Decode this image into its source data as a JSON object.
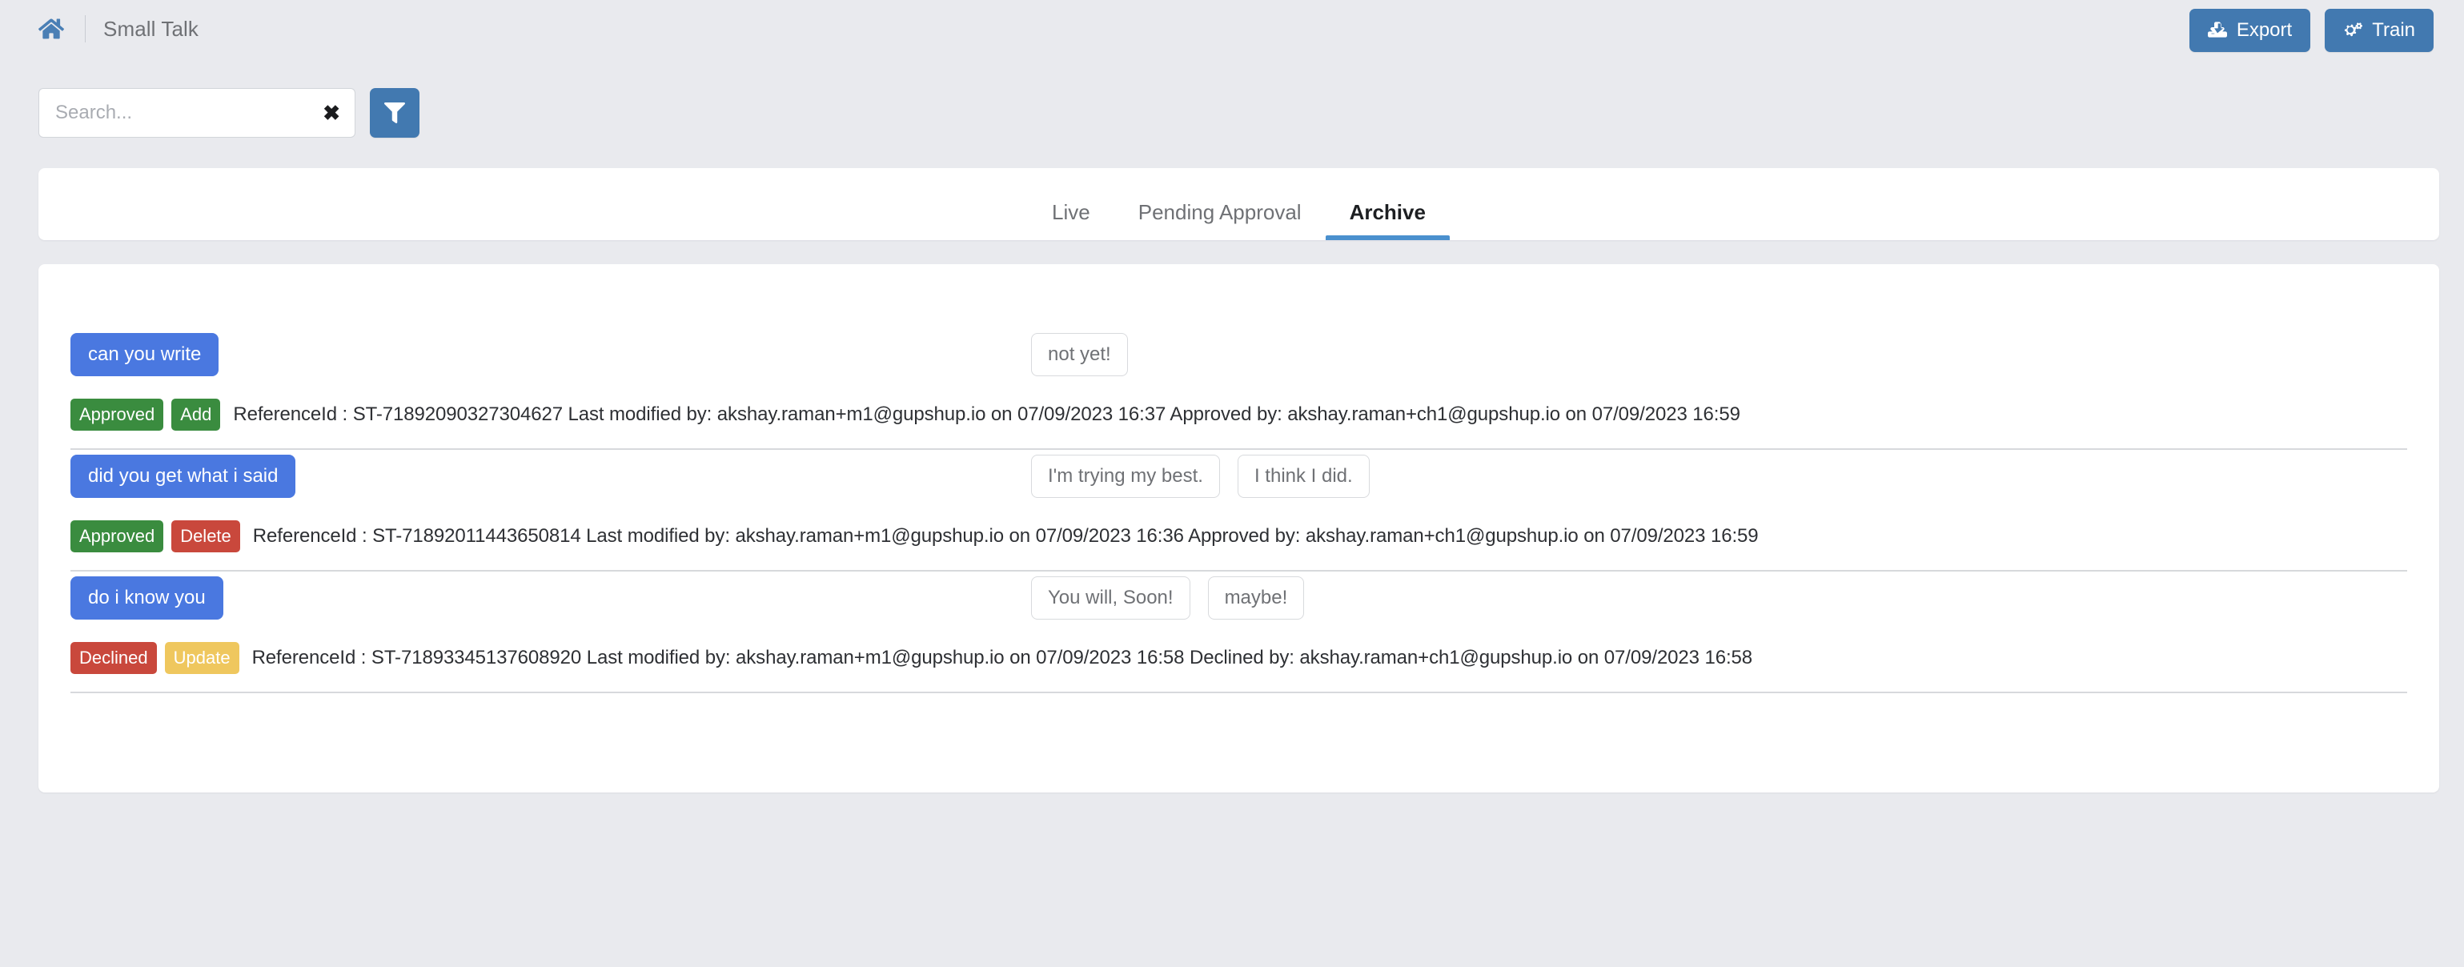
{
  "header": {
    "home_icon": "home-icon",
    "separator": "|",
    "title": "Small Talk",
    "export_label": "Export",
    "export_icon": "upload-icon",
    "train_label": "Train",
    "train_icon": "cogs-icon"
  },
  "search": {
    "placeholder": "Search...",
    "value": "",
    "clear_icon": "✖",
    "filter_icon": "filter-icon"
  },
  "tabs": [
    {
      "label": "Live",
      "active": false
    },
    {
      "label": "Pending Approval",
      "active": false
    },
    {
      "label": "Archive",
      "active": true
    }
  ],
  "rows": [
    {
      "question": "can you write",
      "answers": [
        "not yet!"
      ],
      "badges": [
        {
          "label": "Approved",
          "style": "approved"
        },
        {
          "label": "Add",
          "style": "add"
        }
      ],
      "meta": "ReferenceId : ST-71892090327304627 Last modified by: akshay.raman+m1@gupshup.io on 07/09/2023 16:37 Approved by: akshay.raman+ch1@gupshup.io on 07/09/2023 16:59"
    },
    {
      "question": "did you get what i said",
      "answers": [
        "I'm trying my best.",
        "I think I did."
      ],
      "badges": [
        {
          "label": "Approved",
          "style": "approved"
        },
        {
          "label": "Delete",
          "style": "delete"
        }
      ],
      "meta": "ReferenceId : ST-71892011443650814 Last modified by: akshay.raman+m1@gupshup.io on 07/09/2023 16:36 Approved by: akshay.raman+ch1@gupshup.io on 07/09/2023 16:59"
    },
    {
      "question": "do i know you",
      "answers": [
        "You will, Soon!",
        "maybe!"
      ],
      "badges": [
        {
          "label": "Declined",
          "style": "declined"
        },
        {
          "label": "Update",
          "style": "update"
        }
      ],
      "meta": "ReferenceId : ST-71893345137608920 Last modified by: akshay.raman+m1@gupshup.io on 07/09/2023 16:58 Declined by: akshay.raman+ch1@gupshup.io on 07/09/2023 16:58"
    }
  ],
  "colors": {
    "page_bg": "#e9eaee",
    "primary": "#4279b0",
    "tab_active_underline": "#4a90ce",
    "question_bubble": "#4a78e0",
    "approved": "#3a8c3f",
    "declined": "#c9483c",
    "update": "#efc75e"
  }
}
